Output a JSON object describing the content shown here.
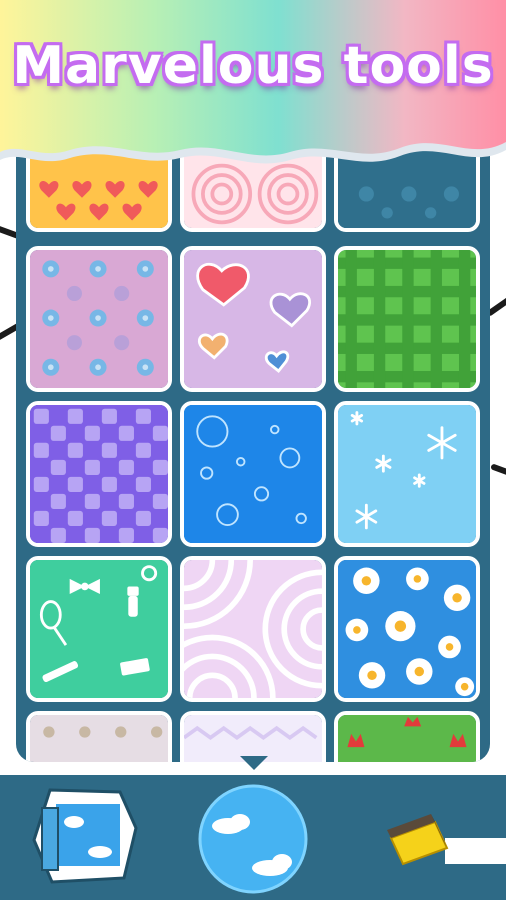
{
  "banner": {
    "title": "Marvelous tools"
  },
  "patterns": [
    {
      "name": "hearts-yellow"
    },
    {
      "name": "circles-pink"
    },
    {
      "name": "fleur-blue"
    },
    {
      "name": "flowers-purple"
    },
    {
      "name": "hearts-lilac"
    },
    {
      "name": "gingham-green"
    },
    {
      "name": "checker-violet"
    },
    {
      "name": "bubbles-blue"
    },
    {
      "name": "snowflakes-skyblue"
    },
    {
      "name": "accessories-mint"
    },
    {
      "name": "swirl-lavender"
    },
    {
      "name": "daisies-blue"
    },
    {
      "name": "dots-gray"
    },
    {
      "name": "zigzag-lavender"
    },
    {
      "name": "tulips-green"
    }
  ],
  "tools": {
    "left": "paper-sheet-tool",
    "center": "sky-background-tool",
    "right": "eraser-tool"
  },
  "colors": {
    "panel": "#2e6a86",
    "title_outline": "#c46cf0"
  }
}
